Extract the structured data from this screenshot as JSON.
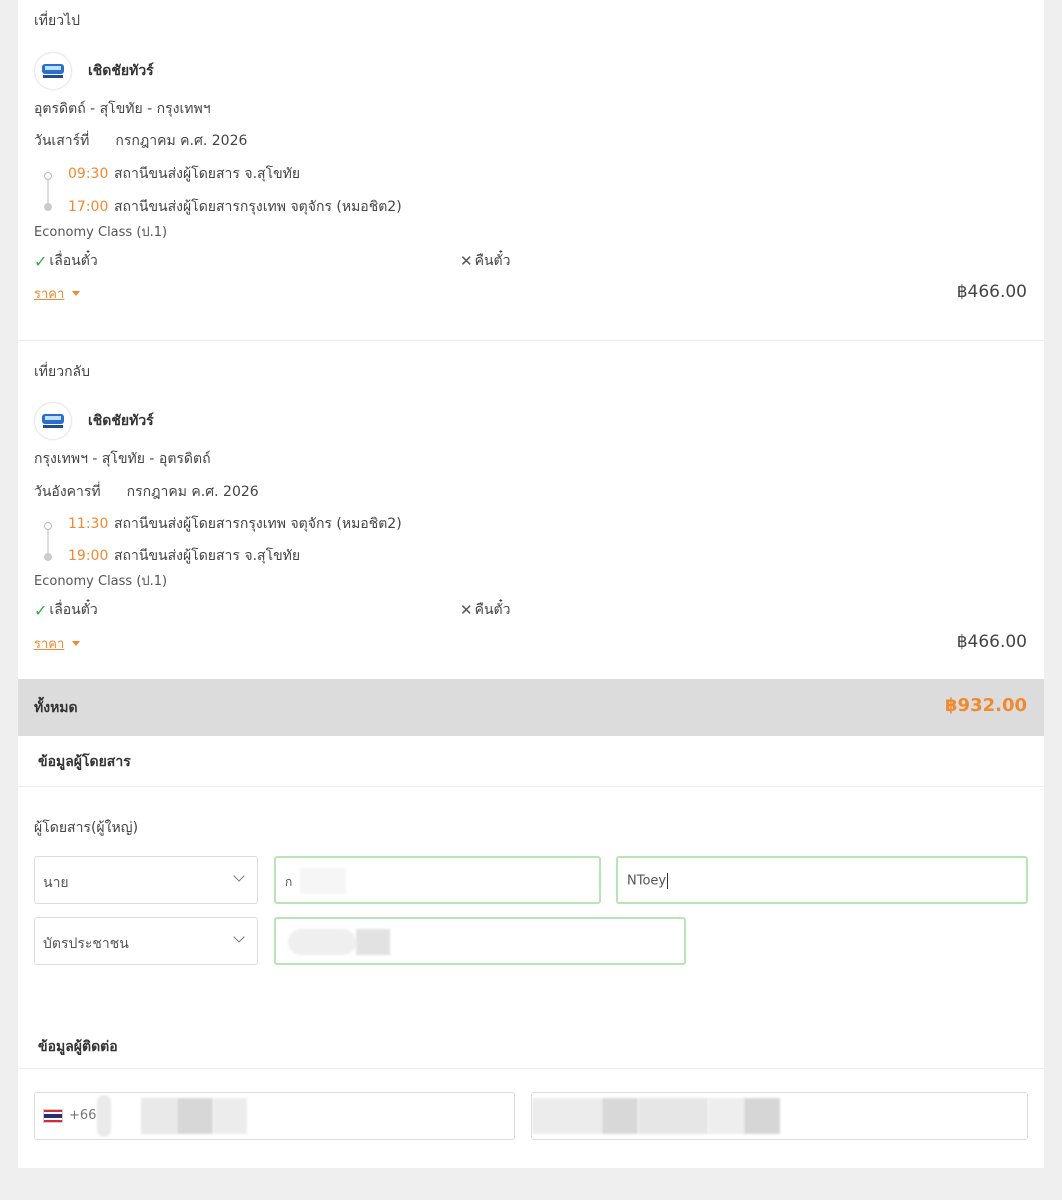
{
  "outbound": {
    "label": "เที่ยวไป",
    "operator": "เชิดชัยทัวร์",
    "route": "อุตรดิตถ์ - สุโขทัย - กรุงเทพฯ",
    "date_prefix": "วันเสาร์ที่",
    "date_rest": "กรกฎาคม ค.ศ. 2026",
    "stops": [
      {
        "time": "09:30",
        "place": "สถานีขนส่งผู้โดยสาร จ.สุโขทัย"
      },
      {
        "time": "17:00",
        "place": "สถานีขนส่งผู้โดยสารกรุงเทพ จตุจักร (หมอชิต2)"
      }
    ],
    "class": "Economy Class (ป.1)",
    "change_label": "เลื่อนตั๋ว",
    "refund_label": "คืนตั๋ว",
    "price_link": "ราคา",
    "price": "฿466.00"
  },
  "return": {
    "label": "เที่ยวกลับ",
    "operator": "เชิดชัยทัวร์",
    "route": "กรุงเทพฯ - สุโขทัย - อุตรดิตถ์",
    "date_prefix": "วันอังคารที่",
    "date_rest": "กรกฎาคม ค.ศ. 2026",
    "stops": [
      {
        "time": "11:30",
        "place": "สถานีขนส่งผู้โดยสารกรุงเทพ จตุจักร (หมอชิต2)"
      },
      {
        "time": "19:00",
        "place": "สถานีขนส่งผู้โดยสาร จ.สุโขทัย"
      }
    ],
    "class": "Economy Class (ป.1)",
    "change_label": "เลื่อนตั๋ว",
    "refund_label": "คืนตั๋ว",
    "price_link": "ราคา",
    "price": "฿466.00"
  },
  "total": {
    "label": "ทั้งหมด",
    "price": "฿932.00"
  },
  "passenger": {
    "section_title": "ข้อมูลผู้โดยสาร",
    "label": "ผู้โดยสาร(ผู้ใหญ่)",
    "title_value": "นาย",
    "first_name_value": "ก",
    "last_name_value": "NToey",
    "id_type_value": "บัตรประชาชน"
  },
  "contact": {
    "section_title": "ข้อมูลผู้ติดต่อ",
    "country_code": "+66"
  },
  "colors": {
    "accent": "#f0892f",
    "success": "#2fae4a",
    "field_focus": "#b7e5b4"
  }
}
